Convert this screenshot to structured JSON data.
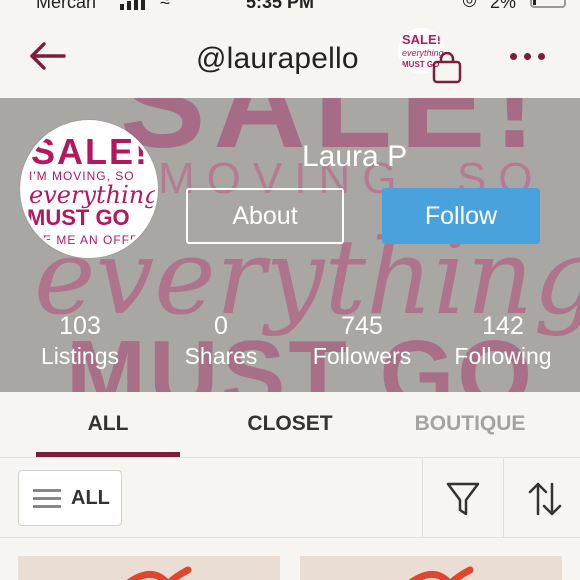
{
  "status_bar": {
    "carrier": "Mercari",
    "time": "5:35 PM",
    "battery": "2%"
  },
  "header": {
    "username": "@laurapello",
    "back_icon": "arrow-left-icon",
    "bag_icon": "shopping-bag-icon",
    "more_icon": "more-dots-icon",
    "thumb_text": [
      "SALE!",
      "everything",
      "MUST GO"
    ]
  },
  "profile": {
    "name": "Laura P",
    "about_label": "About",
    "follow_label": "Follow",
    "avatar_text": [
      "SALE!",
      "I'M MOVING, SO",
      "everything",
      "MUST GO",
      "AKE ME AN OFFE"
    ],
    "cover_text": [
      "SALE!",
      "MOVING, SO",
      "everything",
      "MUST GO"
    ],
    "stats": [
      {
        "value": "103",
        "label": "Listings"
      },
      {
        "value": "0",
        "label": "Shares"
      },
      {
        "value": "745",
        "label": "Followers"
      },
      {
        "value": "142",
        "label": "Following"
      }
    ]
  },
  "tabs": [
    {
      "label": "ALL",
      "active": true
    },
    {
      "label": "CLOSET",
      "active": false
    },
    {
      "label": "BOUTIQUE",
      "active": false
    }
  ],
  "filter_bar": {
    "all_label": "ALL",
    "filter_icon": "filter-funnel-icon",
    "sort_icon": "sort-arrows-icon"
  },
  "colors": {
    "accent": "#7c1d3a",
    "follow": "#4aa2dc",
    "sale_pink": "#b5175e",
    "background": "#f6f5f2"
  }
}
